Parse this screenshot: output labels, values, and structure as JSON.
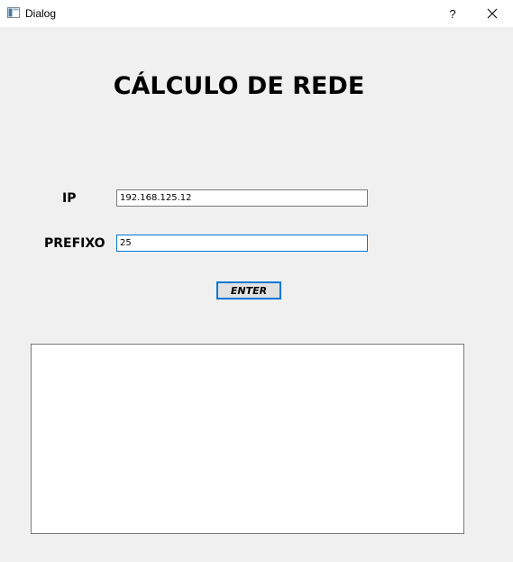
{
  "window": {
    "title": "Dialog",
    "help_label": "?",
    "close_label": "✕"
  },
  "form": {
    "heading": "CÁLCULO DE REDE",
    "ip_label": "IP",
    "ip_value": "192.168.125.12",
    "prefix_label": "PREFIXO",
    "prefix_value": "25",
    "enter_label": "ENTER",
    "output_value": ""
  }
}
